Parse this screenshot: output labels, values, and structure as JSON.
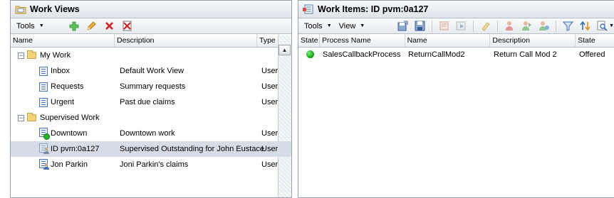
{
  "colors": {
    "selected_row": "#d7dde6",
    "pane_border": "#9aa3ad",
    "status_green": "#22b322",
    "add_green": "#3bb33b",
    "delete_red": "#d42020"
  },
  "left": {
    "title": "Work Views",
    "title_icon": "folder-views-icon",
    "toolbar": {
      "tools_label": "Tools",
      "icons": [
        "add-icon",
        "edit-pencil-icon",
        "delete-x-icon",
        "delete-all-icon"
      ]
    },
    "columns": [
      "Name",
      "Description",
      "Type"
    ],
    "tree": [
      {
        "kind": "folder",
        "name": "My Work",
        "expander": "−",
        "description": "",
        "type": ""
      },
      {
        "kind": "view",
        "name": "Inbox",
        "description": "Default Work View",
        "type": "User"
      },
      {
        "kind": "view",
        "name": "Requests",
        "description": "Summary requests",
        "type": "User"
      },
      {
        "kind": "view",
        "name": "Urgent",
        "description": "Past due claims",
        "type": "User"
      },
      {
        "kind": "folder",
        "name": "Supervised Work",
        "expander": "−",
        "description": "",
        "type": ""
      },
      {
        "kind": "supervised",
        "name": "Downtown",
        "description": "Downtown work",
        "type": "User"
      },
      {
        "kind": "supervised-user",
        "name": "ID pvm:0a127",
        "description": "Supervised Outstanding for John Eustace",
        "type": "User",
        "selected": true
      },
      {
        "kind": "supervised-user",
        "name": "Jon Parkin",
        "description": "Joni Parkin's claims",
        "type": "User"
      }
    ]
  },
  "right": {
    "title": "Work Items: ID pvm:0a127",
    "title_icon": "work-items-icon",
    "toolbar": {
      "tools_label": "Tools",
      "view_label": "View",
      "icons": [
        "save-as-icon",
        "save-icon",
        "open-item-icon",
        "process-icon",
        "highlight-icon",
        "allocate-icon",
        "reallocate-icon",
        "reassign-icon",
        "filter-icon",
        "sort-icon",
        "find-icon"
      ]
    },
    "columns": [
      "State",
      "Process Name",
      "Name",
      "Description",
      "State"
    ],
    "rows": [
      {
        "status_color": "#22b322",
        "process_name": "SalesCallbackProcess",
        "name": "ReturnCallMod2",
        "description": "Return Call Mod 2",
        "state": "Offered"
      }
    ]
  }
}
